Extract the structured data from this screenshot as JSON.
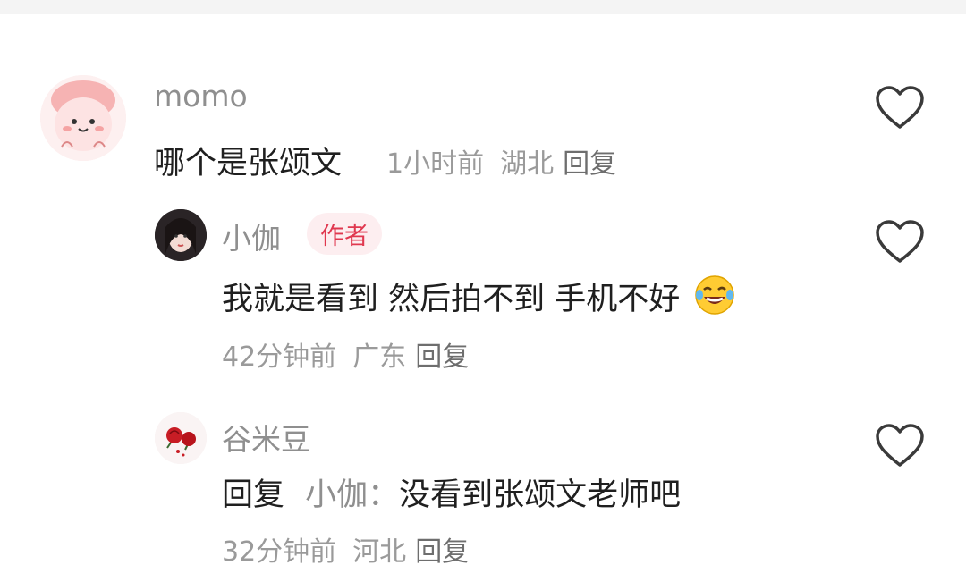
{
  "comments": [
    {
      "username": "momo",
      "text": "哪个是张颂文",
      "time": "1小时前",
      "location": "湖北",
      "reply_label": "回复"
    }
  ],
  "replies": [
    {
      "username": "小伽",
      "badge": "作者",
      "text": "我就是看到 然后拍不到 手机不好",
      "emoji": "laughing-crying-emoji",
      "time": "42分钟前",
      "location": "广东",
      "reply_label": "回复"
    },
    {
      "username": "谷米豆",
      "reply_prefix": "回复",
      "mention": "小伽：",
      "text": "没看到张颂文老师吧",
      "time": "32分钟前",
      "location": "河北",
      "reply_label": "回复"
    }
  ],
  "icons": {
    "like": "heart-outline-icon"
  },
  "colors": {
    "badge_bg": "#fdeef0",
    "badge_text": "#e0384f",
    "username": "#8f8f8f",
    "meta": "#9a9a9a"
  }
}
